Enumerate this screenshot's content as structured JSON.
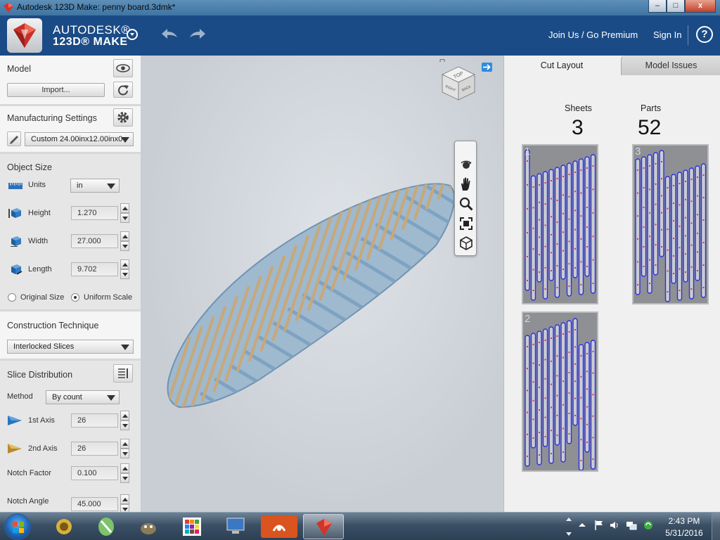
{
  "window": {
    "title": "Autodesk 123D Make: penny board.3dmk*",
    "minimize": "–",
    "maximize": "□",
    "close": "x"
  },
  "header": {
    "brand_line1": "AUTODESK®",
    "brand_line2": "123D® MAKE",
    "join_label": "Join Us / Go Premium",
    "signin_label": "Sign In",
    "help_label": "?"
  },
  "left_panel": {
    "model": {
      "title": "Model",
      "import_label": "Import..."
    },
    "manufacturing": {
      "title": "Manufacturing Settings",
      "sheet_value": "Custom 24.00inx12.00inx0"
    },
    "object_size": {
      "title": "Object Size",
      "units_label": "Units",
      "units_value": "in",
      "height_label": "Height",
      "height_value": "1.270",
      "width_label": "Width",
      "width_value": "27.000",
      "length_label": "Length",
      "length_value": "9.702",
      "original_size_label": "Original Size",
      "uniform_scale_label": "Uniform Scale",
      "uniform_scale_selected": true
    },
    "construction": {
      "title": "Construction Technique",
      "value": "Interlocked Slices"
    },
    "slice_distribution": {
      "title": "Slice Distribution",
      "method_label": "Method",
      "method_value": "By count",
      "axis1_label": "1st Axis",
      "axis1_value": "26",
      "axis2_label": "2nd Axis",
      "axis2_value": "26",
      "notch_factor_label": "Notch Factor",
      "notch_factor_value": "0.100",
      "notch_angle_label": "Notch Angle",
      "notch_angle_value": "45.000"
    }
  },
  "viewcube": {
    "top_face": "TOP",
    "left_face": "RIGHT",
    "right_face": "BACK"
  },
  "view_toolbar": [
    "orbit-icon",
    "pan-icon",
    "zoom-icon",
    "fit-icon",
    "view-cube-icon"
  ],
  "right_panel": {
    "tabs": [
      {
        "label": "Cut Layout",
        "active": true
      },
      {
        "label": "Model Issues",
        "active": false
      }
    ],
    "sheets_label": "Sheets",
    "sheets_value": "3",
    "parts_label": "Parts",
    "parts_value": "52",
    "sheets": [
      {
        "number": "1"
      },
      {
        "number": "3"
      },
      {
        "number": "2"
      }
    ]
  },
  "taskbar": {
    "apps": [
      "ie-icon",
      "app-green-icon",
      "gimp-icon",
      "grid-app-icon",
      "computer-icon",
      "audio-app-icon",
      "123d-make-icon"
    ],
    "time": "2:43 PM",
    "date": "5/31/2016"
  },
  "colors": {
    "app_header": "#1b4b86",
    "viewport_bg": "#cfd4da",
    "slice_wood": "#c8a878",
    "slice_blue": "#7ea3c2",
    "part_outline": "#2b31e0",
    "notch_red": "#e0303a"
  }
}
